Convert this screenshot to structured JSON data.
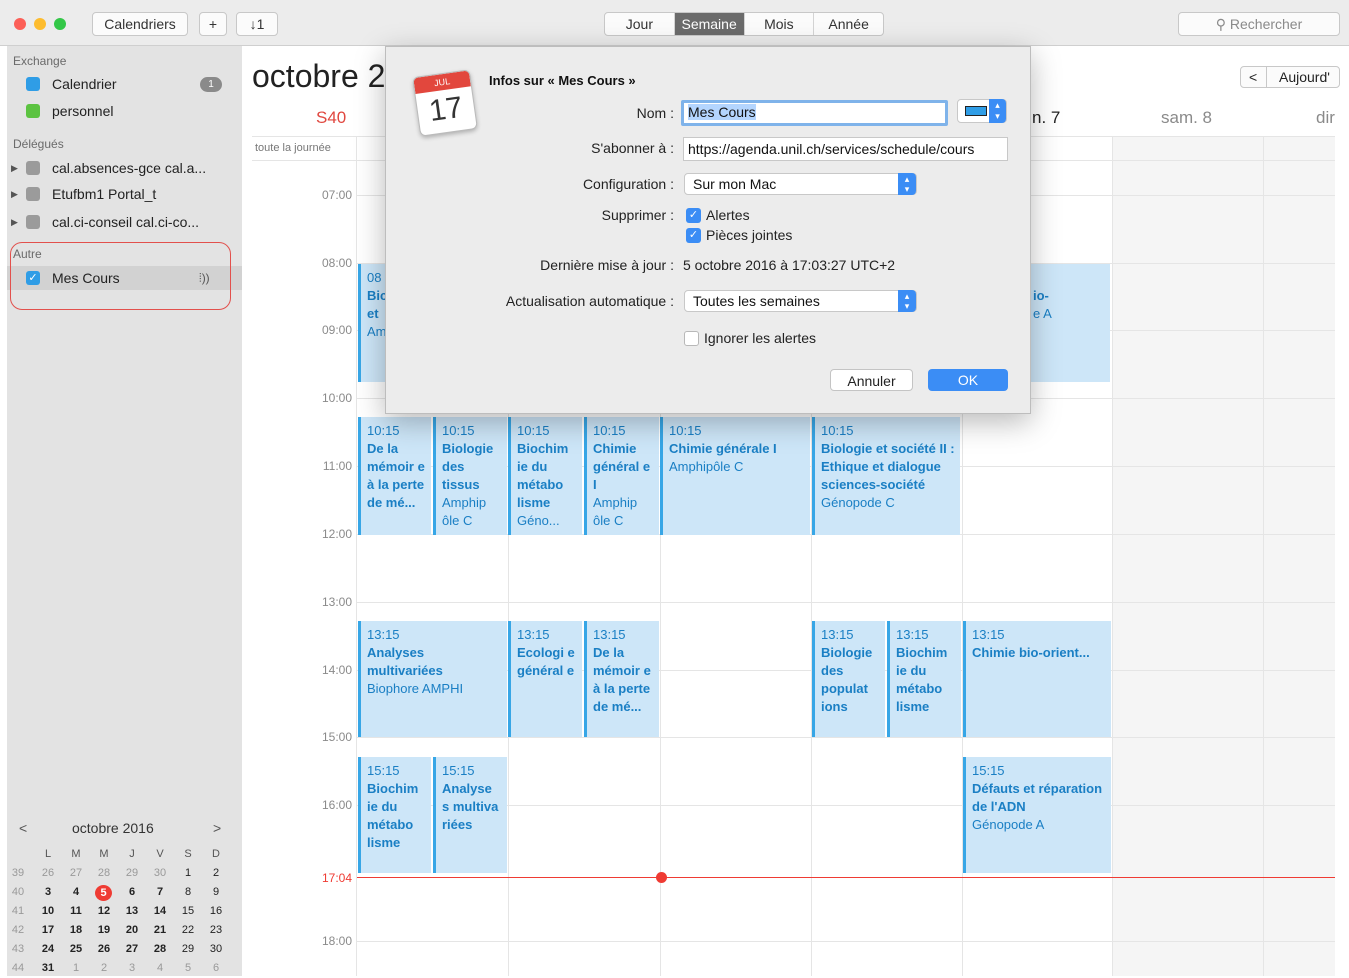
{
  "toolbar": {
    "calendars_label": "Calendriers",
    "add_label": "+",
    "inbox_label": "↓1",
    "views": [
      "Jour",
      "Semaine",
      "Mois",
      "Année"
    ],
    "active_view": "Semaine",
    "search_placeholder": "Rechercher"
  },
  "sidebar": {
    "groups": [
      {
        "heading": "Exchange"
      },
      {
        "heading": "Délégués"
      },
      {
        "heading": "Autre"
      }
    ],
    "items": [
      {
        "label": "Calendrier",
        "color": "#2f9de6",
        "badge": "1"
      },
      {
        "label": "personnel",
        "color": "#5cc341"
      },
      {
        "label": "cal.absences-gce cal.a...",
        "color": "#9b9b9b"
      },
      {
        "label": "Etufbm1 Portal_t",
        "color": "#9b9b9b"
      },
      {
        "label": "cal.ci-conseil cal.ci-co...",
        "color": "#9b9b9b"
      },
      {
        "label": "Mes Cours",
        "color": "#2f9de6",
        "checked": true
      }
    ],
    "check_mark": "✓",
    "subscribed_icon": "broadcast-icon",
    "disclosure_icon": "▶"
  },
  "mini_calendar": {
    "title": "octobre 2016",
    "prev": "<",
    "next": ">",
    "day_headers": [
      "L",
      "M",
      "M",
      "J",
      "V",
      "S",
      "D"
    ],
    "today": "5",
    "weeks": [
      {
        "wk": "39",
        "days": [
          "26",
          "27",
          "28",
          "29",
          "30",
          "1",
          "2"
        ]
      },
      {
        "wk": "40",
        "days": [
          "3",
          "4",
          "5",
          "6",
          "7",
          "8",
          "9"
        ]
      },
      {
        "wk": "41",
        "days": [
          "10",
          "11",
          "12",
          "13",
          "14",
          "15",
          "16"
        ]
      },
      {
        "wk": "42",
        "days": [
          "17",
          "18",
          "19",
          "20",
          "21",
          "22",
          "23"
        ]
      },
      {
        "wk": "43",
        "days": [
          "24",
          "25",
          "26",
          "27",
          "28",
          "29",
          "30"
        ]
      },
      {
        "wk": "44",
        "days": [
          "31",
          "1",
          "2",
          "3",
          "4",
          "5",
          "6"
        ]
      }
    ]
  },
  "main": {
    "month_title": "octobre 2",
    "week_label": "S40",
    "all_day_label": "toute la journée",
    "today_button": "Aujourd'",
    "prev_button": "<",
    "day_headers": [
      {
        "label": "n. 7"
      },
      {
        "label": "sam. 8"
      },
      {
        "label": "dir"
      }
    ],
    "hours": [
      "07:00",
      "08:00",
      "09:00",
      "10:00",
      "11:00",
      "12:00",
      "13:00",
      "14:00",
      "15:00",
      "16:00",
      "18:00"
    ],
    "now_label": "17:04"
  },
  "events": [
    {
      "time": "08",
      "title": "Bic et",
      "place": "Am"
    },
    {
      "time": "",
      "title": "io-",
      "place": "e A"
    },
    {
      "time": "10:15",
      "title": "De la mémoir e à la perte de mé...",
      "place": ""
    },
    {
      "time": "10:15",
      "title": "Biologie des tissus",
      "place": "Amphip ôle C"
    },
    {
      "time": "10:15",
      "title": "Biochim ie du métabo lisme",
      "place": "Géno..."
    },
    {
      "time": "10:15",
      "title": "Chimie général e I",
      "place": "Amphip ôle C"
    },
    {
      "time": "10:15",
      "title": "Chimie générale I",
      "place": "Amphipôle C"
    },
    {
      "time": "10:15",
      "title": "Biologie et société II : Ethique et dialogue sciences-société",
      "place": "Génopode C"
    },
    {
      "time": "13:15",
      "title": "Analyses multivariées",
      "place": "Biophore AMPHI"
    },
    {
      "time": "13:15",
      "title": "Ecologi e général e",
      "place": ""
    },
    {
      "time": "13:15",
      "title": "De la mémoir e à la perte de mé...",
      "place": ""
    },
    {
      "time": "13:15",
      "title": "Biologie des populat ions",
      "place": ""
    },
    {
      "time": "13:15",
      "title": "Biochim ie du métabo lisme",
      "place": ""
    },
    {
      "time": "13:15",
      "title": "Chimie bio-orient...",
      "place": ""
    },
    {
      "time": "15:15",
      "title": "Biochim ie du métabo lisme",
      "place": ""
    },
    {
      "time": "15:15",
      "title": "Analyse s multiva riées",
      "place": ""
    },
    {
      "time": "15:15",
      "title": "Défauts et réparation de l'ADN",
      "place": "Génopode A"
    }
  ],
  "dialog": {
    "title": "Infos sur « Mes Cours »",
    "icon_month": "JUL",
    "icon_day": "17",
    "name_label": "Nom :",
    "name_value": "Mes Cours",
    "subscribe_label": "S'abonner à :",
    "subscribe_value": "https://agenda.unil.ch/services/schedule/cours",
    "config_label": "Configuration :",
    "config_value": "Sur mon Mac",
    "delete_label": "Supprimer :",
    "delete_alerts": "Alertes",
    "delete_attachments": "Pièces jointes",
    "last_update_label": "Dernière mise à jour :",
    "last_update_value": "5 octobre 2016 à 17:03:27 UTC+2",
    "auto_refresh_label": "Actualisation automatique :",
    "auto_refresh_value": "Toutes les semaines",
    "ignore_alerts": "Ignorer les alertes",
    "cancel": "Annuler",
    "ok": "OK",
    "color_value": "#2f9de6"
  }
}
